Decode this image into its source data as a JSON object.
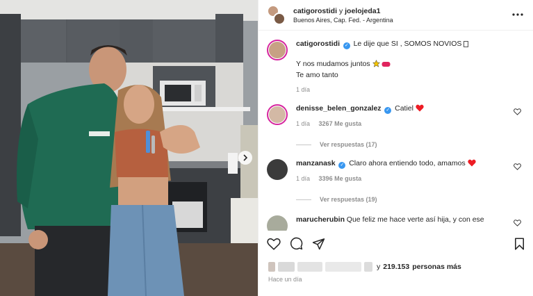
{
  "header": {
    "user1": "catigorostidi",
    "conjunction": "y",
    "user2": "joelojeda1",
    "location": "Buenos Aires, Cap. Fed. - Argentina",
    "more_icon": "more-horizontal-icon"
  },
  "caption": {
    "username": "catigorostidi",
    "text": "Le dije que SI , SOMOS NOVIOS",
    "line2": "Y nos mudamos juntos",
    "line3": "Te amo tanto",
    "time": "1 día"
  },
  "comments": [
    {
      "username": "denisse_belen_gonzalez",
      "text": "Catiel",
      "time": "1 día",
      "likes": "3267 Me gusta",
      "replies": "Ver respuestas (17)"
    },
    {
      "username": "manzanask",
      "text": "Claro ahora entiendo todo, amamos",
      "time": "1 día",
      "likes": "3396 Me gusta",
      "replies": "Ver respuestas (19)"
    },
    {
      "username": "marucherubin",
      "text": "Que feliz me hace verte así hija, y con ese"
    }
  ],
  "likes": {
    "others_count": "219.153",
    "prefix": "y",
    "suffix": "personas más"
  },
  "posted": "Hace un día",
  "colors": {
    "heart": "#ed4956",
    "verified": "#3897f0",
    "story_ring": "#d6249f",
    "muted_text": "#8e8e8e"
  }
}
